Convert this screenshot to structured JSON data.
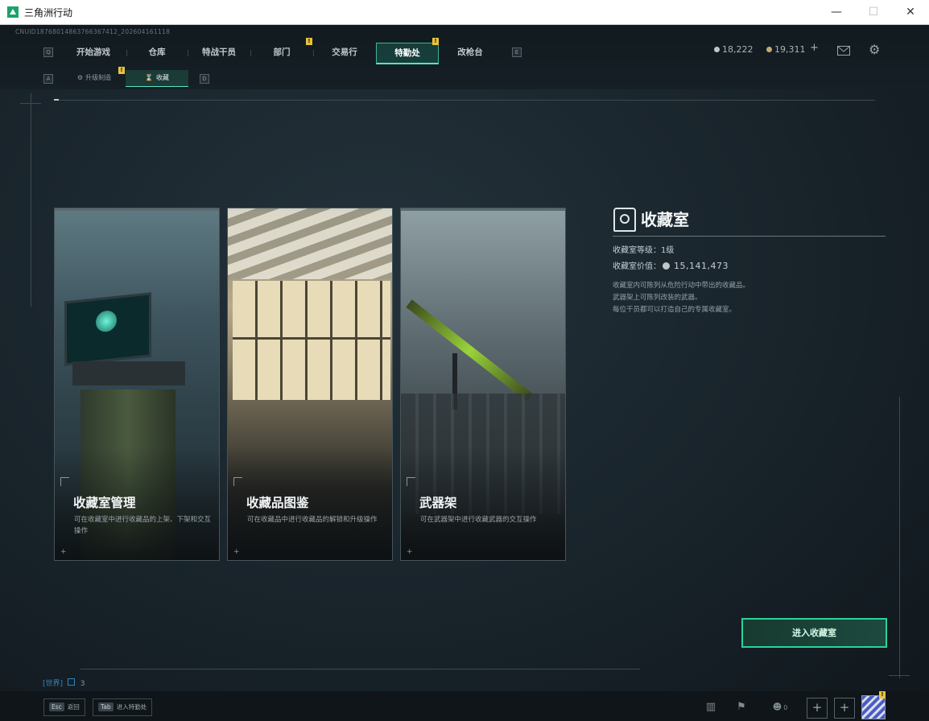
{
  "window": {
    "title": "三角洲行动",
    "minimize": "—",
    "maximize": "☐",
    "close": "✕"
  },
  "header": {
    "uid": "CNUID18768014863766367412_202604161118",
    "key_left": "Q",
    "key_right": "E",
    "tabs": [
      {
        "label": "开始游戏"
      },
      {
        "label": "仓库"
      },
      {
        "label": "特战干员"
      },
      {
        "label": "部门",
        "alert": "!"
      },
      {
        "label": "交易行"
      },
      {
        "label": "特勤处",
        "alert": "!",
        "active": true
      },
      {
        "label": "改枪台"
      }
    ],
    "currency_1": "18,222",
    "currency_2": "19,311",
    "add_symbol": "+",
    "mail_icon": "mail-icon",
    "settings_icon": "gear-icon"
  },
  "subnav": {
    "key_left": "A",
    "key_right": "D",
    "tabs": [
      {
        "label": "升级制造",
        "alert": "!"
      },
      {
        "label": "收藏",
        "active": true
      }
    ]
  },
  "cards": [
    {
      "title": "收藏室管理",
      "desc": "可在收藏室中进行收藏品的上架、下架和交互操作"
    },
    {
      "title": "收藏品图鉴",
      "desc": "可在收藏品中进行收藏品的解锁和升级操作"
    },
    {
      "title": "武器架",
      "desc": "可在武器架中进行收藏武器的交互操作"
    }
  ],
  "info": {
    "title": "收藏室",
    "level_label": "收藏室等级：",
    "level_value": "1级",
    "value_label": "收藏室价值：",
    "value_amount": "15,141,473",
    "desc_1": "收藏室内可陈列从危险行动中带出的收藏品。",
    "desc_2": "武器架上可陈列改装的武器。",
    "desc_3": "每位干员都可以打造自己的专属收藏室。",
    "enter_button": "进入收藏室"
  },
  "chat": {
    "channel": "[世界]",
    "count": "3"
  },
  "bottom": {
    "esc_key": "Esc",
    "esc_label": "返回",
    "tab_key": "Tab",
    "tab_label": "进入特勤处",
    "friends_count": "0",
    "plus": "+",
    "avatar_alert": "!"
  },
  "colors": {
    "accent": "#2dd29a",
    "alert": "#e9c23c",
    "background": "#18232a"
  }
}
